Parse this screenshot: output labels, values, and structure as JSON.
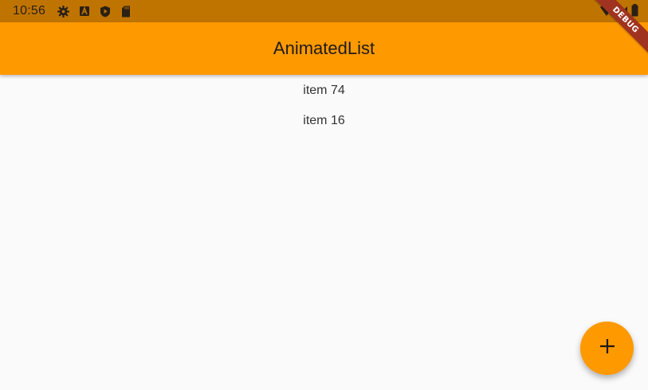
{
  "status_bar": {
    "time": "10:56",
    "icons": [
      "gear-icon",
      "a-box-icon",
      "shield-play-icon",
      "sd-card-icon"
    ],
    "right_icons": [
      "wifi-icon",
      "signal-icon",
      "battery-icon"
    ]
  },
  "app_bar": {
    "title": "AnimatedList"
  },
  "debug_banner": "DEBUG",
  "list": {
    "items": [
      {
        "label": "item 74"
      },
      {
        "label": "item 16"
      }
    ]
  },
  "fab": {
    "icon": "plus-icon"
  },
  "colors": {
    "status_bar": "#c07400",
    "app_bar": "#ff9900",
    "background": "#fafafa",
    "debug_banner": "#a0331f"
  }
}
